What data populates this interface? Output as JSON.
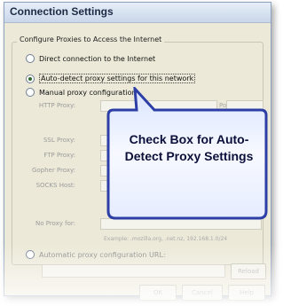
{
  "dialog": {
    "title": "Connection Settings",
    "group_label": "Configure Proxies to Access the Internet",
    "options": [
      {
        "label": "Direct connection to the Internet",
        "selected": false
      },
      {
        "label": "Auto-detect proxy settings for this network",
        "selected": true
      },
      {
        "label": "Manual proxy configuration:",
        "selected": false
      }
    ],
    "fields": {
      "http": "HTTP Proxy:",
      "ssl": "SSL Proxy:",
      "ftp": "FTP Proxy:",
      "gopher": "Gopher Proxy:",
      "socks": "SOCKS Host:",
      "noproxy": "No Proxy for:",
      "port": "Port:"
    },
    "example": "Example: .mozilla.org, .net.nz, 192.168.1.0/24",
    "auto_url_label": "Automatic proxy configuration URL:",
    "buttons": {
      "reload": "Reload",
      "ok": "OK",
      "cancel": "Cancel",
      "help": "Help"
    }
  },
  "callout": {
    "text": "Check Box for Auto-Detect Proxy Settings"
  }
}
